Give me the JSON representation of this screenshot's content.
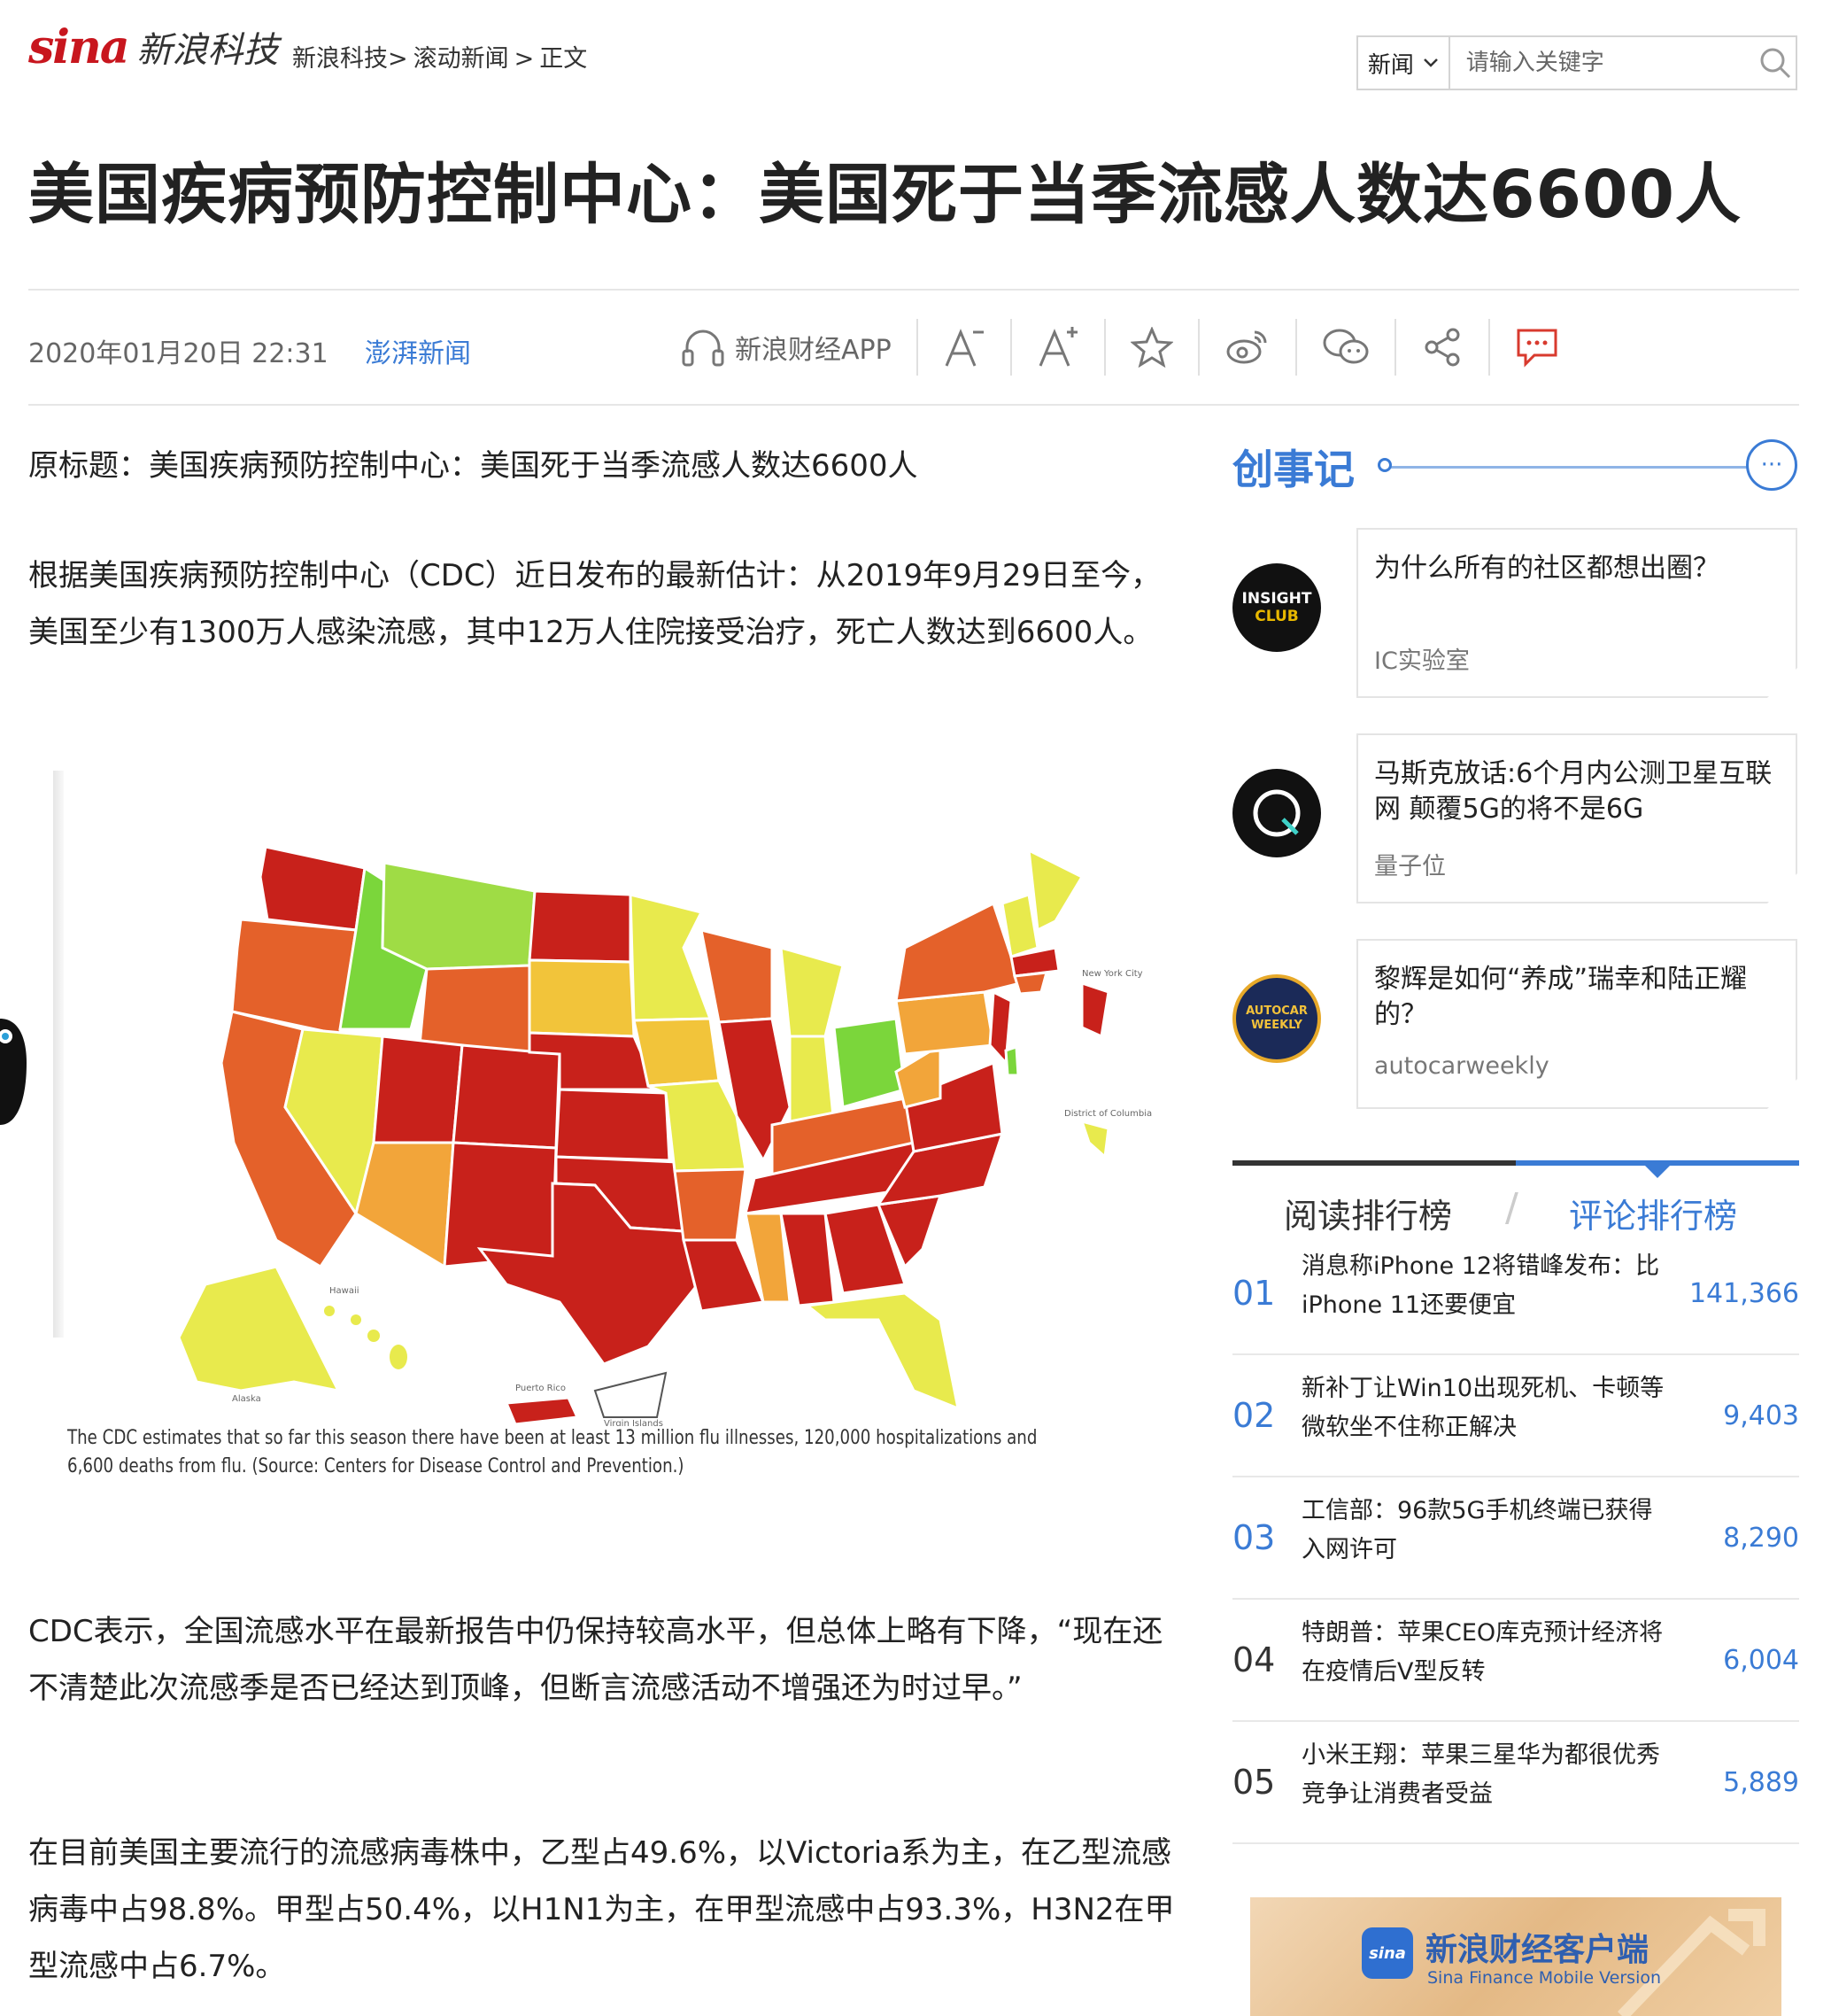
{
  "header": {
    "logo_sina": "sina",
    "logo_tech": "新浪科技",
    "breadcrumb": [
      "新浪科技>",
      "滚动新闻",
      ">",
      "正文"
    ],
    "search": {
      "category": "新闻",
      "placeholder": "请输入关键字"
    }
  },
  "article": {
    "title": "美国疾病预防控制中心：美国死于当季流感人数达6600人",
    "date": "2020年01月20日 22:31",
    "source": "澎湃新闻",
    "toolbar": {
      "app_label": "新浪财经APP"
    },
    "paragraphs": [
      "原标题：美国疾病预防控制中心：美国死于当季流感人数达6600人",
      "根据美国疾病预防控制中心（CDC）近日发布的最新估计：从2019年9月29日至今，美国至少有1300万人感染流感，其中12万人住院接受治疗，死亡人数达到6600人。",
      "CDC表示，全国流感水平在最新报告中仍保持较高水平，但总体上略有下降，“现在还不清楚此次流感季是否已经达到顶峰，但断言流感活动不增强还为时过早。”",
      "在目前美国主要流行的流感病毒株中，乙型占49.6%，以Victoria系为主，在乙型流感病毒中占98.8%。甲型占50.4%，以H1N1为主，在甲型流感中占93.3%，H3N2在甲型流感中占6.7%。"
    ],
    "figure": {
      "caption": "The CDC estimates that so far this season there have been at least 13 million flu illnesses, 120,000 hospitalizations and 6,600 deaths from flu. (Source: Centers for Disease Control and Prevention.)",
      "labels": {
        "new_york_city": "New York City",
        "dc": "District of Columbia",
        "hawaii": "Hawaii",
        "alaska": "Alaska",
        "puerto_rico": "Puerto Rico",
        "virgin_islands": "Virgin Islands"
      },
      "colors": {
        "high": "#c8211b",
        "mod_high": "#e4612a",
        "moderate": "#f2a53a",
        "low": "#e8ea4d",
        "minimal": "#7bd63b"
      }
    }
  },
  "sidebar": {
    "heading": "创事记",
    "more": "···",
    "cards": [
      {
        "title": "为什么所有的社区都想出圈？",
        "source": "IC实验室",
        "avatar_text": [
          "INSIGHT",
          "CLUB"
        ]
      },
      {
        "title": "马斯克放话:6个月内公测卫星互联网 颠覆5G的将不是6G",
        "source": "量子位"
      },
      {
        "title": "黎辉是如何“养成”瑞幸和陆正耀的？",
        "source": "autocarweekly",
        "avatar_text": [
          "AUTOCAR",
          "WEEKLY"
        ]
      }
    ],
    "rank_tabs": {
      "read": "阅读排行榜",
      "separator": "/",
      "comment": "评论排行榜"
    },
    "rankings": [
      {
        "num": "01",
        "title": "消息称iPhone 12将错峰发布：比iPhone 11还要便宜",
        "count": "141,366"
      },
      {
        "num": "02",
        "title": "新补丁让Win10出现死机、卡顿等 微软坐不住称正解决",
        "count": "9,403"
      },
      {
        "num": "03",
        "title": "工信部：96款5G手机终端已获得入网许可",
        "count": "8,290"
      },
      {
        "num": "04",
        "title": "特朗普：苹果CEO库克预计经济将在疫情后V型反转",
        "count": "6,004"
      },
      {
        "num": "05",
        "title": "小米王翔：苹果三星华为都很优秀 竞争让消费者受益",
        "count": "5,889"
      }
    ],
    "banner": {
      "logo": "sina",
      "title": "新浪财经客户端",
      "subtitle": "Sina Finance Mobile Version"
    }
  }
}
